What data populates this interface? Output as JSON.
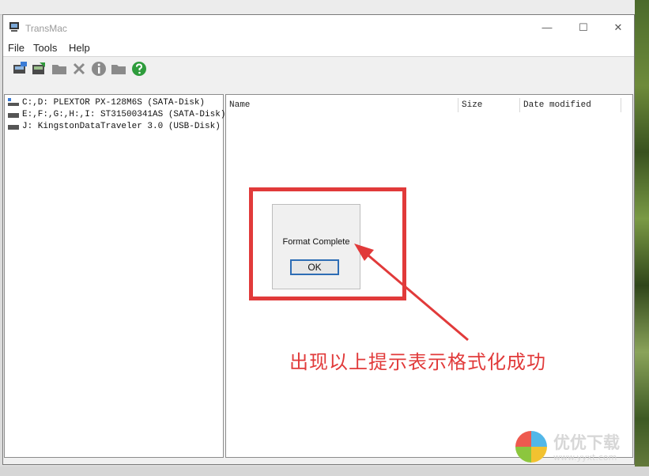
{
  "window": {
    "title": "TransMac",
    "controls": {
      "minimize": "—",
      "maximize": "☐",
      "close": "✕"
    }
  },
  "menu": [
    "File",
    "Tools",
    "Help"
  ],
  "toolbar": {
    "icons": [
      "disk-image-icon",
      "restore-disk-icon",
      "folder-icon",
      "delete-icon",
      "info-icon",
      "folder-open-icon",
      "help-icon"
    ]
  },
  "drives": [
    {
      "label": "C:,D: PLEXTOR PX-128M6S (SATA-Disk)"
    },
    {
      "label": "E:,F:,G:,H:,I: ST31500341AS (SATA-Disk)"
    },
    {
      "label": "J: KingstonDataTraveler 3.0 (USB-Disk)"
    }
  ],
  "file_list": {
    "columns": [
      "Name",
      "Size",
      "Date modified"
    ]
  },
  "dialog": {
    "message": "Format Complete",
    "ok_label": "OK"
  },
  "annotation": "出现以上提示表示格式化成功",
  "watermark": {
    "text": "优优下载",
    "url": "www.yyxt.com"
  },
  "colors": {
    "highlight": "#e13a3a",
    "ok_border": "#2d6db5"
  }
}
